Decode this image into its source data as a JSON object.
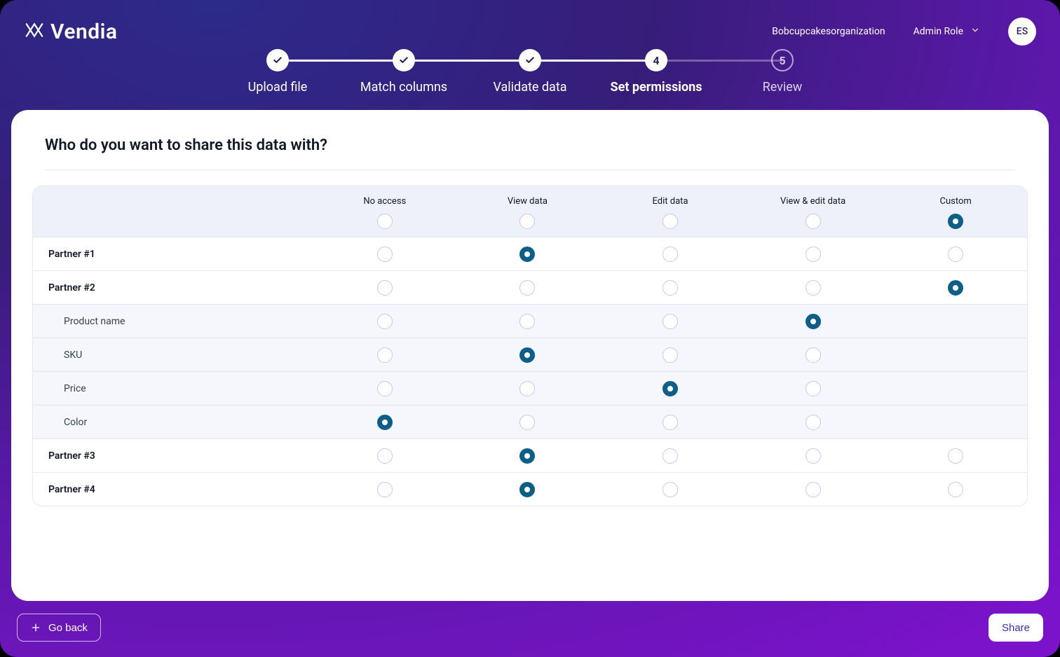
{
  "header": {
    "brand": "Vendia",
    "org": "Bobcupcakesorganization",
    "role_label": "Admin Role",
    "avatar_initials": "ES"
  },
  "stepper": {
    "steps": [
      {
        "label": "Upload file",
        "state": "done"
      },
      {
        "label": "Match columns",
        "state": "done"
      },
      {
        "label": "Validate data",
        "state": "done"
      },
      {
        "label": "Set permissions",
        "state": "active",
        "number": "4"
      },
      {
        "label": "Review",
        "state": "upcoming",
        "number": "5"
      }
    ]
  },
  "card": {
    "title": "Who do you want to share this data with?",
    "columns": [
      "No access",
      "View data",
      "Edit data",
      "View & edit data",
      "Custom"
    ],
    "header_selection": [
      0,
      0,
      0,
      0,
      1
    ],
    "rows": [
      {
        "label": "Partner #1",
        "type": "partner",
        "selection": [
          0,
          1,
          0,
          0,
          0
        ]
      },
      {
        "label": "Partner #2",
        "type": "partner",
        "selection": [
          0,
          0,
          0,
          0,
          1
        ]
      },
      {
        "label": "Product name",
        "type": "field",
        "selection": [
          0,
          0,
          0,
          1,
          null
        ]
      },
      {
        "label": "SKU",
        "type": "field",
        "selection": [
          0,
          1,
          0,
          0,
          null
        ]
      },
      {
        "label": "Price",
        "type": "field",
        "selection": [
          0,
          0,
          1,
          0,
          null
        ]
      },
      {
        "label": "Color",
        "type": "field",
        "selection": [
          1,
          0,
          0,
          0,
          null
        ]
      },
      {
        "label": "Partner #3",
        "type": "partner",
        "selection": [
          0,
          1,
          0,
          0,
          0
        ]
      },
      {
        "label": "Partner #4",
        "type": "partner",
        "selection": [
          0,
          1,
          0,
          0,
          0
        ]
      }
    ]
  },
  "footer": {
    "back_label": "Go back",
    "share_label": "Share"
  }
}
